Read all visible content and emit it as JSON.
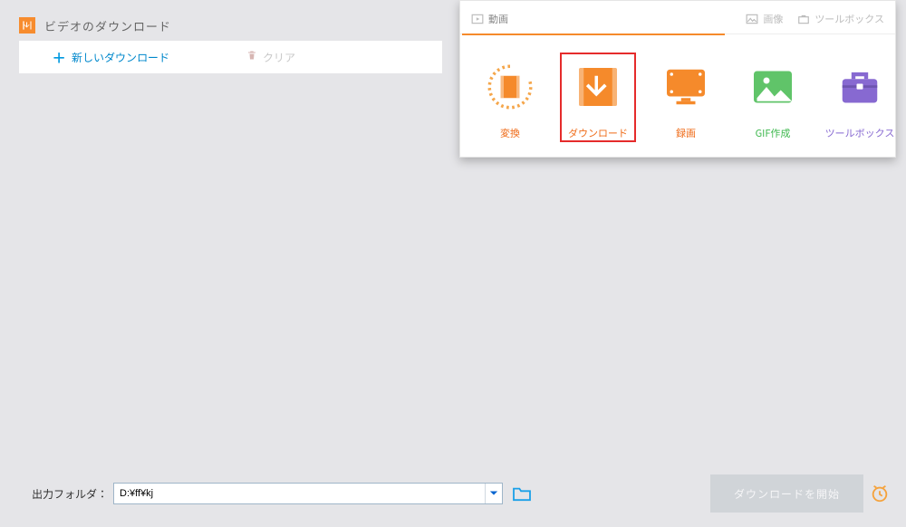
{
  "header": {
    "title": "ビデオのダウンロード"
  },
  "toolbar": {
    "add_label": "新しいダウンロード",
    "clear_label": "クリア"
  },
  "bottom": {
    "output_folder_label": "出力フォルダ：",
    "output_folder_value": "D:¥ff¥kj",
    "start_label": "ダウンロードを開始"
  },
  "panel": {
    "tabs": {
      "video": "動画",
      "image": "画像",
      "toolbox": "ツールボックス"
    },
    "tiles": {
      "convert": "変換",
      "download": "ダウンロード",
      "record": "録画",
      "gif": "GIF作成",
      "toolbox": "ツールボックス"
    }
  },
  "colors": {
    "accent_orange": "#f58a2b",
    "accent_green": "#60c469",
    "accent_purple": "#8769d1",
    "accent_red": "#e52b2b",
    "accent_blue": "#0099e0"
  }
}
